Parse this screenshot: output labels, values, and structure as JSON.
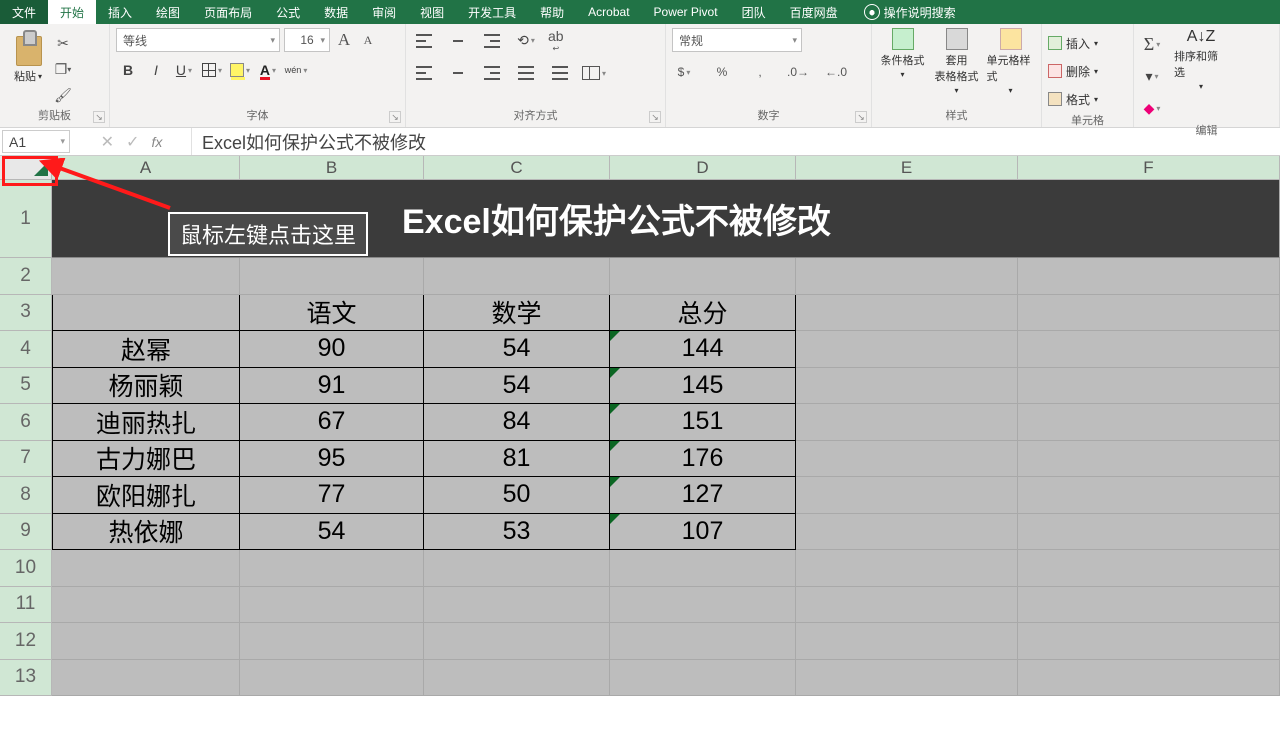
{
  "tabs": {
    "file": "文件",
    "home": "开始",
    "insert": "插入",
    "draw": "绘图",
    "layout": "页面布局",
    "formulas": "公式",
    "data": "数据",
    "review": "审阅",
    "view": "视图",
    "dev": "开发工具",
    "help": "帮助",
    "acrobat": "Acrobat",
    "powerpivot": "Power Pivot",
    "team": "团队",
    "baidu": "百度网盘",
    "tellme": "操作说明搜索"
  },
  "clipboard": {
    "paste": "粘贴",
    "group": "剪贴板"
  },
  "font": {
    "name": "等线",
    "size": "16",
    "group": "字体"
  },
  "align": {
    "wrap": "自动换行",
    "group": "对齐方式"
  },
  "number": {
    "format": "常规",
    "group": "数字"
  },
  "styles": {
    "cond": "条件格式",
    "table": "套用\n表格格式",
    "cell": "单元格样式",
    "group": "样式"
  },
  "cells": {
    "insert": "插入",
    "delete": "删除",
    "format": "格式",
    "group": "单元格"
  },
  "edit": {
    "sort": "排序和筛选",
    "group": "编辑"
  },
  "namebox": "A1",
  "formula_bar": "Excel如何保护公式不被修改",
  "columns": [
    "A",
    "B",
    "C",
    "D",
    "E",
    "F"
  ],
  "row_labels": [
    "1",
    "2",
    "3",
    "4",
    "5",
    "6",
    "7",
    "8",
    "9",
    "10",
    "11",
    "12",
    "13"
  ],
  "title_cell": "Excel如何保护公式不被修改",
  "tooltip": "鼠标左键点击这里",
  "headers": {
    "b": "语文",
    "c": "数学",
    "d": "总分"
  },
  "rows": [
    {
      "a": "赵幂",
      "b": "90",
      "c": "54",
      "d": "144"
    },
    {
      "a": "杨丽颖",
      "b": "91",
      "c": "54",
      "d": "145"
    },
    {
      "a": "迪丽热扎",
      "b": "67",
      "c": "84",
      "d": "151"
    },
    {
      "a": "古力娜巴",
      "b": "95",
      "c": "81",
      "d": "176"
    },
    {
      "a": "欧阳娜扎",
      "b": "77",
      "c": "50",
      "d": "127"
    },
    {
      "a": "热依娜",
      "b": "54",
      "c": "53",
      "d": "107"
    }
  ]
}
